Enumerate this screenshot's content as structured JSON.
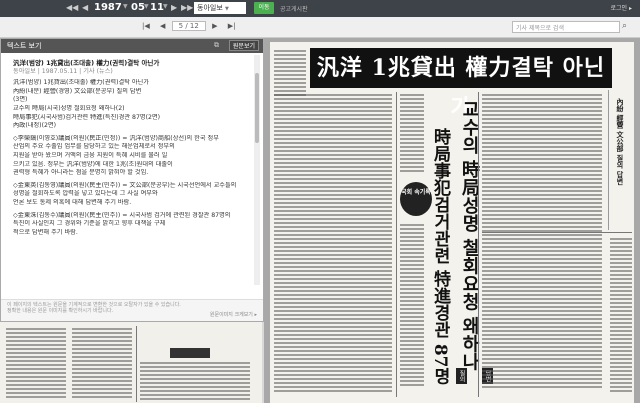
{
  "header": {
    "nav_prev": "◀◀",
    "nav_prev2": "◀",
    "year": "1987",
    "month": "05",
    "day": "11",
    "nav_next": "▶",
    "nav_next2": "▶▶",
    "paper": "동아일보",
    "go": "이동",
    "period": "공고게시판",
    "login": "로그인 ▸"
  },
  "pager": {
    "first": "|◀",
    "prev": "◀",
    "current": "5",
    "total": "12",
    "next": "▶",
    "last": "▶|",
    "sep": "/"
  },
  "search": {
    "placeholder": "기사 제목으로 검색"
  },
  "panel": {
    "title": "텍스트 보기",
    "button": "원문보기",
    "article_title": "汎洋(범양) 1兆貸出(조대출) 權力(권력)결탁 아닌가",
    "meta": "동아일보 | 1987.05.11 | 기사 (뉴스)",
    "lines": [
      "汎洋(범양) 1兆貸出(조대출) 權力(권력)결탁 아닌가",
      "內紛(내분) 經營(경영) 文公部(문공부) 질의 답변",
      "(3면)",
      "교수의 時局(시국)성명 철회요청 왜하나(2)",
      "時局事犯(시국사범)검거관련 特進(특진)경관 87명(2면)",
      "內政(내정)(2면)"
    ],
    "para1": [
      "◇李榮鎬(이영호)議員(의원)(民正(민정)) = 汎洋(범양)商船(상선)의 한국 정부",
      "산업의 주요 수출입 업무를 담당하고 있는 해운업체로서 정부의",
      "지원을 받아 왔으며 거액의 금융 지원이 특혜 시비를 불러 일",
      "으키고 있음. 정부는 汎洋(범양)에 대한 1兆(조)원대의 대출이",
      "권력형 특혜가 아니라는 점을 분명히 밝혀야 할 것임."
    ],
    "para2": [
      "◇金東英(김동영)議員(의원)(民主(민주)) = 文公部(문공부)는 시국선언에서 교수들의",
      "성명을 철회하도록 압력을 넣고 있다는데 그 사실 여부와",
      "언론 보도 통제 의혹에 대해 답변해 주기 바람."
    ],
    "para3": [
      "◇金東洙(김동수)議員(의원)(民主(민주)) = 시국사범 검거에 관련된 경찰관 87명의",
      "특진이 사실인지 그 경위와 기준을 밝히고 향후 대책을 구체",
      "적으로 답변해 주기 바람."
    ],
    "footer1": "이 페이지의 텍스트는 원문을 기계적으로 변환한 것으로 오탈자가 있을 수 있습니다.",
    "footer2": "정확한 내용은 원문 이미지를 확인하시기 바랍니다.",
    "footer_link": "원문이미지 크게보기 ▸"
  },
  "newspaper": {
    "banner": "汎洋 1兆貸出 權力결탁 아닌가",
    "headline2": "교수의 時局성명 철회요청 왜하나",
    "headline3": "時局事犯검거관련 特進경관 87명",
    "badge": "국회 속기록",
    "right_strip": "內紛 經營 文公部 질의 답변",
    "tag1": "답변",
    "tag2": "질의"
  }
}
